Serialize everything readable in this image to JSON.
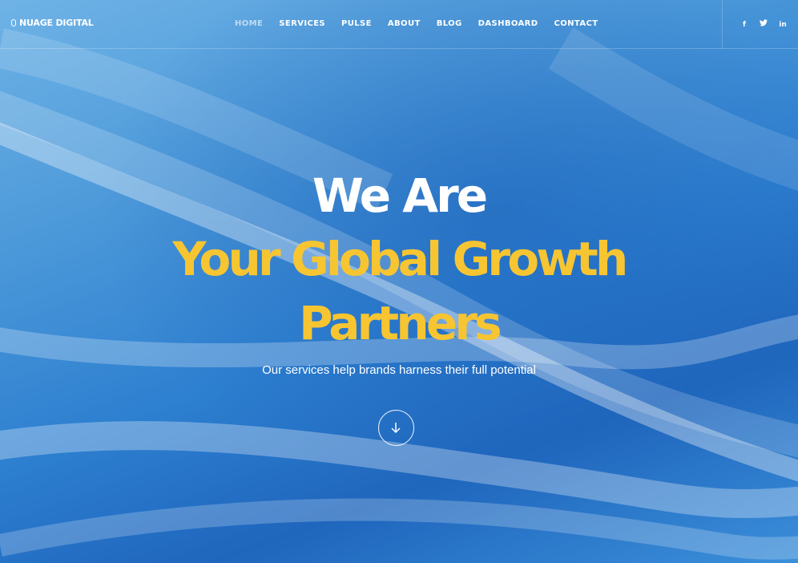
{
  "brand": {
    "name": "NUAGE DIGITAL"
  },
  "nav": {
    "items": [
      {
        "label": "HOME",
        "active": true
      },
      {
        "label": "SERVICES",
        "active": false
      },
      {
        "label": "PULSE",
        "active": false
      },
      {
        "label": "ABOUT",
        "active": false
      },
      {
        "label": "BLOG",
        "active": false
      },
      {
        "label": "DASHBOARD",
        "active": false
      },
      {
        "label": "CONTACT",
        "active": false
      }
    ]
  },
  "social": {
    "facebook": "f",
    "twitter": "twitter-icon",
    "linkedin": "in"
  },
  "hero": {
    "line1": "We Are",
    "line2": "Your Global Growth",
    "line3": "Partners",
    "subtitle": "Our services help brands harness their full potential",
    "scroll_icon": "arrow-down-icon"
  },
  "colors": {
    "accent": "#f7c531",
    "text": "#ffffff",
    "background": "#2d7fd0"
  }
}
